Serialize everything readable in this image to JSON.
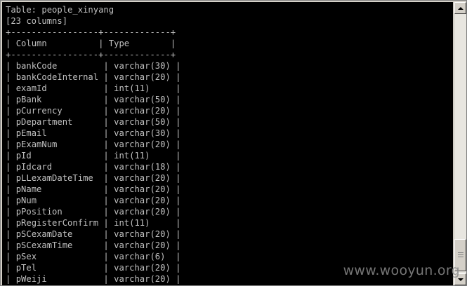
{
  "console": {
    "header_line": "Table: people_xinyang",
    "column_count": "[23 columns]",
    "separator": "+-----------------+-------------+",
    "headers": {
      "column": "Column",
      "type": "Type"
    },
    "rows": [
      {
        "column": "bankCode",
        "type": "varchar(30)"
      },
      {
        "column": "bankCodeInternal",
        "type": "varchar(20)"
      },
      {
        "column": "examId",
        "type": "int(11)"
      },
      {
        "column": "pBank",
        "type": "varchar(50)"
      },
      {
        "column": "pCurrency",
        "type": "varchar(20)"
      },
      {
        "column": "pDepartment",
        "type": "varchar(50)"
      },
      {
        "column": "pEmail",
        "type": "varchar(30)"
      },
      {
        "column": "pExamNum",
        "type": "varchar(20)"
      },
      {
        "column": "pId",
        "type": "int(11)"
      },
      {
        "column": "pIdcard",
        "type": "varchar(18)"
      },
      {
        "column": "pLLexamDateTime",
        "type": "varchar(20)"
      },
      {
        "column": "pName",
        "type": "varchar(20)"
      },
      {
        "column": "pNum",
        "type": "varchar(20)"
      },
      {
        "column": "pPosition",
        "type": "varchar(20)"
      },
      {
        "column": "pRegisterConfirm",
        "type": "int(11)"
      },
      {
        "column": "pSCexamDate",
        "type": "varchar(20)"
      },
      {
        "column": "pSCexamTime",
        "type": "varchar(20)"
      },
      {
        "column": "pSex",
        "type": "varchar(6)"
      },
      {
        "column": "pTel",
        "type": "varchar(20)"
      },
      {
        "column": "pWeiji",
        "type": "varchar(20)"
      }
    ]
  },
  "watermark": "www.wooyun.org",
  "colors": {
    "background": "#000000",
    "text": "#c0c0c0"
  }
}
